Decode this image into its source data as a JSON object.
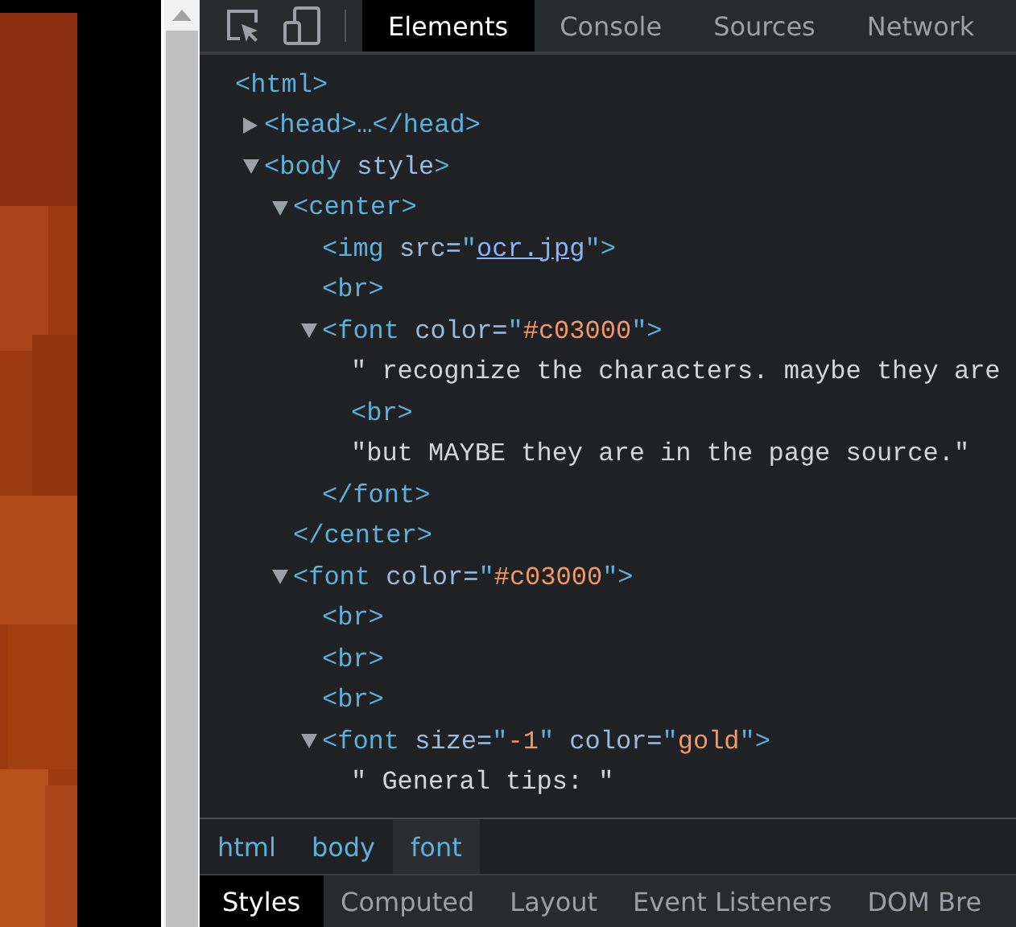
{
  "toolbar": {
    "tabs": [
      {
        "label": "Elements",
        "selected": true
      },
      {
        "label": "Console",
        "selected": false
      },
      {
        "label": "Sources",
        "selected": false
      },
      {
        "label": "Network",
        "selected": false
      }
    ]
  },
  "dom_tree": [
    {
      "tokens": [
        {
          "kind": "tag",
          "text": "<html>"
        }
      ],
      "children": [
        {
          "expanded": false,
          "tokens": [
            {
              "kind": "tag",
              "text": "<head>…</head>"
            }
          ]
        },
        {
          "expanded": true,
          "tokens": [
            {
              "kind": "tag",
              "text": "<body"
            },
            {
              "kind": "attr",
              "text": " style"
            },
            {
              "kind": "tag",
              "text": ">"
            }
          ],
          "children": [
            {
              "expanded": true,
              "tokens": [
                {
                  "kind": "tag",
                  "text": "<center>"
                }
              ],
              "children": [
                {
                  "tokens": [
                    {
                      "kind": "tag",
                      "text": "<img"
                    },
                    {
                      "kind": "attr",
                      "text": " src="
                    },
                    {
                      "kind": "tag",
                      "text": "\""
                    },
                    {
                      "kind": "link",
                      "text": "ocr.jpg"
                    },
                    {
                      "kind": "tag",
                      "text": "\">"
                    }
                  ]
                },
                {
                  "tokens": [
                    {
                      "kind": "tag",
                      "text": "<br>"
                    }
                  ]
                },
                {
                  "expanded": true,
                  "tokens": [
                    {
                      "kind": "tag",
                      "text": "<font"
                    },
                    {
                      "kind": "attr",
                      "text": " color="
                    },
                    {
                      "kind": "tag",
                      "text": "\""
                    },
                    {
                      "kind": "value",
                      "text": "#c03000"
                    },
                    {
                      "kind": "tag",
                      "text": "\">"
                    }
                  ],
                  "children": [
                    {
                      "tokens": [
                        {
                          "kind": "text",
                          "text": "\" recognize the characters. maybe they are"
                        }
                      ]
                    },
                    {
                      "tokens": [
                        {
                          "kind": "tag",
                          "text": "<br>"
                        }
                      ]
                    },
                    {
                      "tokens": [
                        {
                          "kind": "text",
                          "text": "\"but MAYBE they are in the page source.\""
                        }
                      ]
                    }
                  ],
                  "close": [
                    {
                      "kind": "tag",
                      "text": "</font>"
                    }
                  ]
                }
              ],
              "close": [
                {
                  "kind": "tag",
                  "text": "</center>"
                }
              ]
            },
            {
              "expanded": true,
              "tokens": [
                {
                  "kind": "tag",
                  "text": "<font"
                },
                {
                  "kind": "attr",
                  "text": " color="
                },
                {
                  "kind": "tag",
                  "text": "\""
                },
                {
                  "kind": "value",
                  "text": "#c03000"
                },
                {
                  "kind": "tag",
                  "text": "\">"
                }
              ],
              "children": [
                {
                  "tokens": [
                    {
                      "kind": "tag",
                      "text": "<br>"
                    }
                  ]
                },
                {
                  "tokens": [
                    {
                      "kind": "tag",
                      "text": "<br>"
                    }
                  ]
                },
                {
                  "tokens": [
                    {
                      "kind": "tag",
                      "text": "<br>"
                    }
                  ]
                },
                {
                  "expanded": true,
                  "tokens": [
                    {
                      "kind": "tag",
                      "text": "<font"
                    },
                    {
                      "kind": "attr",
                      "text": " size="
                    },
                    {
                      "kind": "tag",
                      "text": "\""
                    },
                    {
                      "kind": "value",
                      "text": "-1"
                    },
                    {
                      "kind": "tag",
                      "text": "\""
                    },
                    {
                      "kind": "attr",
                      "text": " color="
                    },
                    {
                      "kind": "tag",
                      "text": "\""
                    },
                    {
                      "kind": "value",
                      "text": "gold"
                    },
                    {
                      "kind": "tag",
                      "text": "\">"
                    }
                  ],
                  "children": [
                    {
                      "tokens": [
                        {
                          "kind": "text",
                          "text": "\" General tips: \""
                        }
                      ]
                    }
                  ]
                }
              ]
            }
          ]
        }
      ]
    }
  ],
  "breadcrumbs": [
    {
      "label": "html",
      "selected": false
    },
    {
      "label": "body",
      "selected": false
    },
    {
      "label": "font",
      "selected": true
    }
  ],
  "bottom_tabs": [
    {
      "label": "Styles",
      "selected": true
    },
    {
      "label": "Computed",
      "selected": false
    },
    {
      "label": "Layout",
      "selected": false
    },
    {
      "label": "Event Listeners",
      "selected": false
    },
    {
      "label": "DOM Bre",
      "selected": false
    }
  ]
}
